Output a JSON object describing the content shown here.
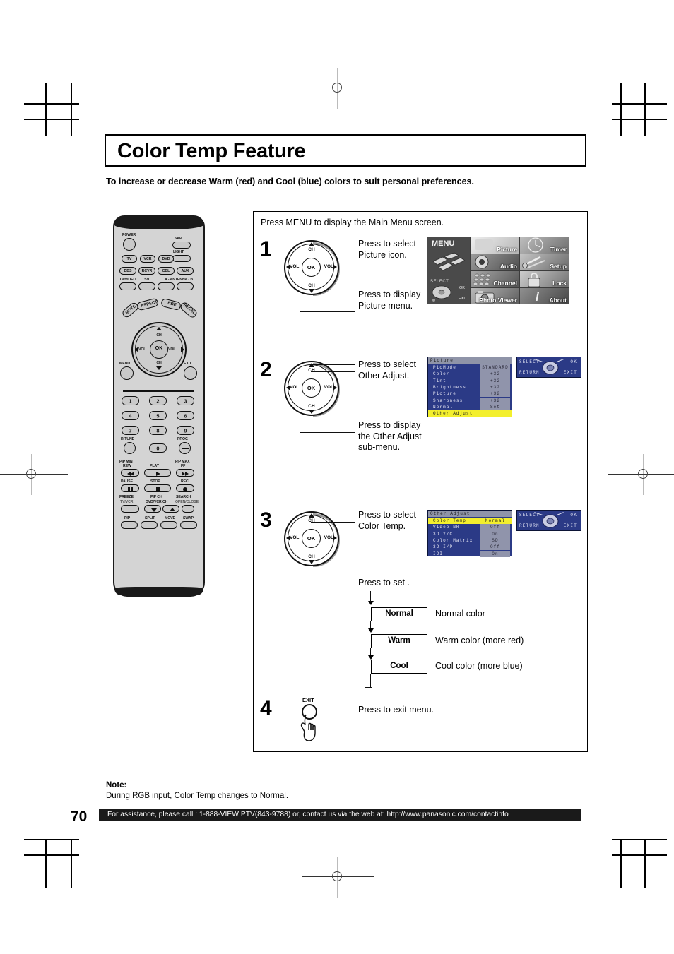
{
  "page": {
    "title": "Color Temp Feature",
    "subtitle": "To increase or decrease Warm (red) and Cool (blue) colors to suit personal preferences.",
    "number": "70"
  },
  "note": {
    "label": "Note:",
    "text": "During RGB input, Color Temp changes to Normal."
  },
  "footer": {
    "text": "For assistance, please call : 1-888-VIEW PTV(843-9788) or, contact us via the web at: http://www.panasonic.com/contactinfo"
  },
  "panel": {
    "intro": "Press MENU to display the Main Menu screen."
  },
  "steps": [
    {
      "number": "1",
      "call_top": "Press to select\nPicture icon.",
      "call_top_l1": "Press to select",
      "call_top_l2": "Picture icon.",
      "call_bottom_l1": "Press to display",
      "call_bottom_l2": "Picture menu.",
      "call_bottom_l3": ""
    },
    {
      "number": "2",
      "call_top_l1": "Press to select",
      "call_top_l2": "Other Adjust.",
      "call_bottom_l1": "Press to display",
      "call_bottom_l2": "the Other Adjust",
      "call_bottom_l3": "sub-menu."
    },
    {
      "number": "3",
      "call_top_l1": "Press to select",
      "call_top_l2": "Color Temp.",
      "call_bottom_l1": "Press to set .",
      "call_bottom_l2": "",
      "call_bottom_l3": ""
    },
    {
      "number": "4",
      "call_top_l1": "Press to exit menu.",
      "call_top_l2": "",
      "call_bottom_l1": "",
      "call_bottom_l2": "",
      "call_bottom_l3": "",
      "button_label": "EXIT"
    }
  ],
  "dial": {
    "ok": "OK",
    "ch_up": "CH",
    "ch_down": "CH",
    "vol_left": "VOL",
    "vol_right": "VOL"
  },
  "main_menu": {
    "title": "MENU",
    "select_label": "SELECT",
    "ok_label": "OK",
    "exit_label": "EXIT",
    "tiles": [
      {
        "label": "Picture"
      },
      {
        "label": "Timer"
      },
      {
        "label": "Audio"
      },
      {
        "label": "Setup"
      },
      {
        "label": "Channel"
      },
      {
        "label": "Lock"
      },
      {
        "label": "Photo Viewer"
      },
      {
        "label": "About"
      }
    ]
  },
  "osd_picture": {
    "header": "Picture",
    "rows": [
      {
        "name": "PicMode",
        "value": "STANDARD",
        "selected": false
      },
      {
        "name": "Color",
        "value": "+32",
        "selected": false
      },
      {
        "name": "Tint",
        "value": "+32",
        "selected": false
      },
      {
        "name": "Brightness",
        "value": "+32",
        "selected": false
      },
      {
        "name": "Picture",
        "value": "+32",
        "selected": false
      },
      {
        "name": "Sharpness",
        "value": "+32",
        "selected": false
      },
      {
        "name": "Normal",
        "value": "Set",
        "selected": false
      },
      {
        "name": "Other Adjust",
        "value": "",
        "selected": true
      }
    ]
  },
  "osd_other_adjust": {
    "header": "Other Adjust",
    "rows": [
      {
        "name": "Color Temp",
        "value": "Normal",
        "selected": true
      },
      {
        "name": "Video NR",
        "value": "Off",
        "selected": false
      },
      {
        "name": "3D Y/C",
        "value": "On",
        "selected": false
      },
      {
        "name": "Color Matrix",
        "value": "SD",
        "selected": false
      },
      {
        "name": "3D I/P",
        "value": "Off",
        "selected": false
      },
      {
        "name": "IDI",
        "value": "On",
        "selected": false
      }
    ]
  },
  "osd_nav": {
    "select": "SELECT",
    "ok": "OK",
    "return": "RETURN",
    "exit": "EXIT"
  },
  "color_temp_flow": [
    {
      "option": "Normal",
      "description": "Normal color"
    },
    {
      "option": "Warm",
      "description": "Warm color (more red)"
    },
    {
      "option": "Cool",
      "description": "Cool color (more blue)"
    }
  ],
  "remote": {
    "power": "POWER",
    "sap": "SAP",
    "light": "LIGHT",
    "device_row1": [
      "TV",
      "VCR",
      "DVD"
    ],
    "device_row2": [
      "DBS",
      "RCVR",
      "CBL",
      "AUX"
    ],
    "input_row_labels": [
      "TV/VIDEO",
      "SD",
      "A - ANTENNA - B"
    ],
    "slant_labels": [
      "MUTE",
      "ASPECT",
      "BBE",
      "RECALL"
    ],
    "nav": {
      "ch_up": "CH",
      "ch_down": "CH",
      "vol_left": "VOL",
      "vol_right": "VOL",
      "ok": "OK"
    },
    "menu": "MENU",
    "exit": "EXIT",
    "numbers": [
      "1",
      "2",
      "3",
      "4",
      "5",
      "6",
      "7",
      "8",
      "9",
      "0"
    ],
    "rtune": "R-TUNE",
    "prog": "PROG",
    "pip_min": "PIP MIN",
    "rew": "REW",
    "play": "PLAY",
    "pip_max": "PIP MAX",
    "ff": "FF",
    "pause": "PAUSE",
    "stop": "STOP",
    "rec": "REC",
    "freeze": "FREEZE",
    "tvvcr": "TV/VCR",
    "pip_ch": "PIP CH",
    "dvd_vcr_ch": "DVD/VCR CH",
    "search": "SEARCH",
    "open_close": "OPEN/CLOSE",
    "bottom_row": [
      "PIP",
      "SPLIT",
      "MOVE",
      "SWAP"
    ]
  }
}
